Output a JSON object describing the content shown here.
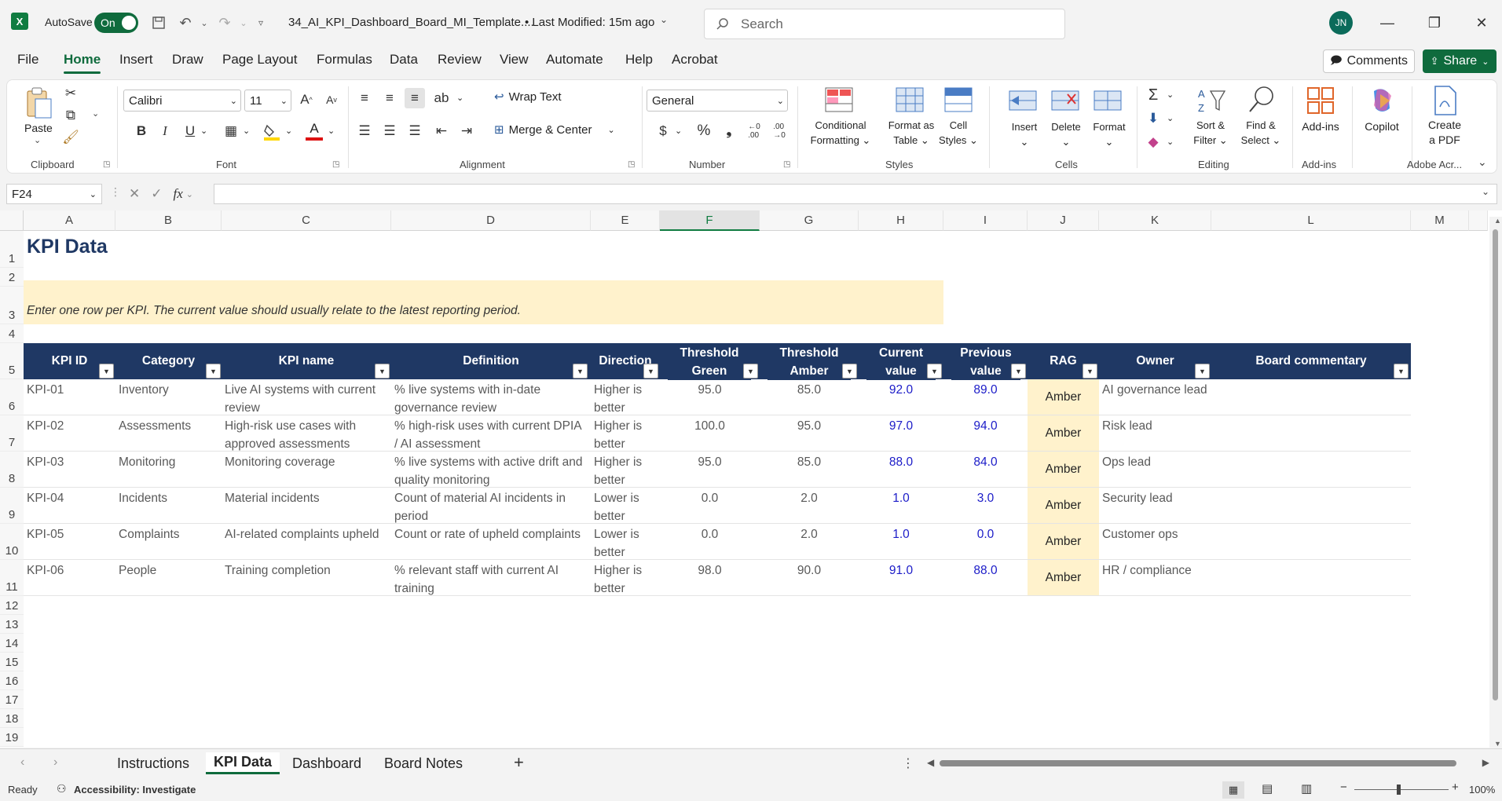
{
  "titlebar": {
    "autosave_label": "AutoSave",
    "autosave_state": "On",
    "filename": "34_AI_KPI_Dashboard_Board_MI_Template....",
    "modified": "•  Last Modified: 15m ago",
    "search_placeholder": "Search",
    "avatar_initials": "JN"
  },
  "menu": {
    "tabs": [
      "File",
      "Home",
      "Insert",
      "Draw",
      "Page Layout",
      "Formulas",
      "Data",
      "Review",
      "View",
      "Automate",
      "Help",
      "Acrobat"
    ],
    "active": "Home",
    "comments_label": "Comments",
    "share_label": "Share"
  },
  "ribbon": {
    "clipboard": {
      "label": "Clipboard",
      "paste": "Paste"
    },
    "font": {
      "label": "Font",
      "family": "Calibri",
      "size": "11"
    },
    "alignment": {
      "label": "Alignment",
      "wrap_text": "Wrap Text",
      "merge_center": "Merge & Center"
    },
    "number": {
      "label": "Number",
      "format": "General"
    },
    "styles": {
      "label": "Styles",
      "conditional": [
        "Conditional",
        "Formatting"
      ],
      "format_table": [
        "Format as",
        "Table"
      ],
      "cell_styles": [
        "Cell",
        "Styles"
      ]
    },
    "cells": {
      "label": "Cells",
      "insert": "Insert",
      "delete": "Delete",
      "format": "Format"
    },
    "editing": {
      "label": "Editing",
      "sort_filter": [
        "Sort &",
        "Filter"
      ],
      "find_select": [
        "Find &",
        "Select"
      ]
    },
    "addins": {
      "label": "Add-ins",
      "addins": "Add-ins"
    },
    "copilot": {
      "copilot": "Copilot"
    },
    "adobe": {
      "label": "Adobe Acr...",
      "create_pdf": [
        "Create",
        "a PDF"
      ]
    }
  },
  "formula_bar": {
    "name_box": "F24",
    "fx": "fx",
    "value": ""
  },
  "columns": [
    "A",
    "B",
    "C",
    "D",
    "E",
    "F",
    "G",
    "H",
    "I",
    "J",
    "K",
    "L",
    "M"
  ],
  "selected_column": "F",
  "rows": [
    "1",
    "2",
    "3",
    "4",
    "5",
    "6",
    "7",
    "8",
    "9",
    "10",
    "11",
    "12",
    "13",
    "14",
    "15",
    "16",
    "17",
    "18",
    "19"
  ],
  "sheet": {
    "title": "KPI Data",
    "instruction": "Enter one row per KPI. The current value should usually relate to the latest reporting period.",
    "headers": [
      "KPI ID",
      "Category",
      "KPI name",
      "Definition",
      "Direction",
      "Threshold Green",
      "Threshold Amber",
      "Current value",
      "Previous value",
      "RAG",
      "Owner",
      "Board commentary"
    ],
    "table": [
      {
        "id": "KPI-01",
        "category": "Inventory",
        "name": "Live AI systems with current review",
        "definition": "% live systems with in-date governance review",
        "direction": "Higher is better",
        "green": "95.0",
        "amber": "85.0",
        "current": "92.0",
        "previous": "89.0",
        "rag": "Amber",
        "owner": "AI governance lead",
        "commentary": ""
      },
      {
        "id": "KPI-02",
        "category": "Assessments",
        "name": "High-risk use cases with approved assessments",
        "definition": "% high-risk uses with current DPIA / AI assessment",
        "direction": "Higher is better",
        "green": "100.0",
        "amber": "95.0",
        "current": "97.0",
        "previous": "94.0",
        "rag": "Amber",
        "owner": "Risk lead",
        "commentary": ""
      },
      {
        "id": "KPI-03",
        "category": "Monitoring",
        "name": "Monitoring coverage",
        "definition": "% live systems with active drift and quality monitoring",
        "direction": "Higher is better",
        "green": "95.0",
        "amber": "85.0",
        "current": "88.0",
        "previous": "84.0",
        "rag": "Amber",
        "owner": "Ops lead",
        "commentary": ""
      },
      {
        "id": "KPI-04",
        "category": "Incidents",
        "name": "Material incidents",
        "definition": "Count of material AI incidents in period",
        "direction": "Lower is better",
        "green": "0.0",
        "amber": "2.0",
        "current": "1.0",
        "previous": "3.0",
        "rag": "Amber",
        "owner": "Security lead",
        "commentary": ""
      },
      {
        "id": "KPI-05",
        "category": "Complaints",
        "name": "AI-related complaints upheld",
        "definition": "Count or rate of upheld complaints",
        "direction": "Lower is better",
        "green": "0.0",
        "amber": "2.0",
        "current": "1.0",
        "previous": "0.0",
        "rag": "Amber",
        "owner": "Customer ops",
        "commentary": ""
      },
      {
        "id": "KPI-06",
        "category": "People",
        "name": "Training completion",
        "definition": "% relevant staff with current AI training",
        "direction": "Higher is better",
        "green": "98.0",
        "amber": "90.0",
        "current": "91.0",
        "previous": "88.0",
        "rag": "Amber",
        "owner": "HR / compliance",
        "commentary": ""
      }
    ]
  },
  "sheet_tabs": [
    "Instructions",
    "KPI Data",
    "Dashboard",
    "Board Notes"
  ],
  "active_sheet": "KPI Data",
  "status": {
    "ready": "Ready",
    "accessibility": "Accessibility: Investigate",
    "zoom": "100%"
  },
  "colors": {
    "accent": "#0f6b3d",
    "header_fill": "#1f3864",
    "instruction_fill": "#fff2cc",
    "rag_amber": "#fff2cc",
    "value_blue": "#1c1cc8",
    "title_navy": "#1f3864"
  }
}
